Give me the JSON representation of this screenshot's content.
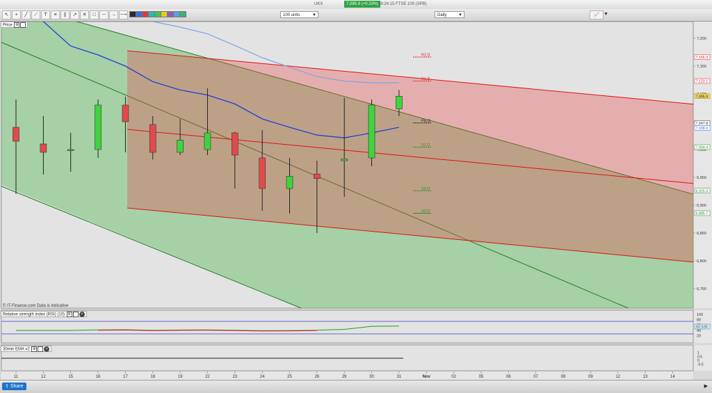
{
  "header": {
    "instrument": "UKX",
    "price_badge": "7,095.9 (+0.23%)",
    "info": "08:24:15 FTSE 100 (SPB)"
  },
  "toolbar": {
    "units_select": "100 units",
    "period_select": "Daily",
    "swatch_colors": [
      "#2b2b2b",
      "#3a6ed8",
      "#d83a3a",
      "#2bb8b8",
      "#4ac24a",
      "#e0d020",
      "#9b59b6",
      "#5aa0e0",
      "#3cb371"
    ]
  },
  "price_panel": {
    "title": "Price",
    "copyright": "© IT-Finance.com  Data is indicative",
    "y_ticks": [
      "7,200",
      "7,150",
      "7,100",
      "7,050",
      "7,000",
      "6,950",
      "6,900",
      "6,850",
      "6,800",
      "6,750"
    ],
    "right_badges": [
      {
        "text": "7,166.3",
        "value": 7166.3,
        "color": "#d22"
      },
      {
        "text": "7,123.1",
        "value": 7123.1,
        "color": "#d22"
      },
      {
        "text": "7,095.9",
        "value": 7095.9,
        "color": "#f3d65a"
      },
      {
        "text": "7,047.8",
        "value": 7047.8,
        "color": "#333"
      },
      {
        "text": "7,038.9",
        "value": 7038.9,
        "color": "#3a6ed8"
      },
      {
        "text": "7,004.4",
        "value": 7004.4,
        "color": "#2a8a2a"
      },
      {
        "text": "6,925.9",
        "value": 6925.9,
        "color": "#2a8a2a"
      },
      {
        "text": "6,885.7",
        "value": 6885.7,
        "color": "#2a8a2a"
      }
    ],
    "pivots": [
      {
        "label": "R2 D",
        "value": 7166.3,
        "color": "#d22"
      },
      {
        "label": "R1 D",
        "value": 7123.1,
        "color": "#d22"
      },
      {
        "label": "Piv D",
        "value": 7047.8,
        "color": "#222"
      },
      {
        "label": "S1 D",
        "value": 7004.4,
        "color": "#2a8a2a"
      },
      {
        "label": "S2 D",
        "value": 6925.9,
        "color": "#2a8a2a"
      },
      {
        "label": "S3 D",
        "value": 6885.7,
        "color": "#2a8a2a"
      }
    ]
  },
  "rsi_panel": {
    "title": "Relative strength index (RSI) (10)",
    "y_ticks": [
      "100",
      "80",
      "60",
      "40",
      "20"
    ],
    "value_badge": "60.536"
  },
  "ema_panel": {
    "title": "30min EMA v2",
    "y_ticks": [
      "1",
      "0.5",
      "0",
      "-0.5"
    ]
  },
  "x_axis": {
    "labels": [
      "11",
      "12",
      "15",
      "16",
      "17",
      "18",
      "19",
      "22",
      "23",
      "24",
      "25",
      "26",
      "29",
      "30",
      "31",
      "Nov",
      "02",
      "05",
      "06",
      "07",
      "08",
      "09",
      "12",
      "13",
      "14"
    ]
  },
  "footer": {
    "share_label": "Share"
  },
  "chart_data": {
    "type": "candlestick",
    "categories": [
      "11",
      "12",
      "15",
      "16",
      "17",
      "18",
      "19",
      "22",
      "23",
      "24",
      "25",
      "26",
      "29",
      "30",
      "31"
    ],
    "candles": [
      {
        "open": 7040,
        "high": 7090,
        "low": 6920,
        "close": 7015
      },
      {
        "open": 7010,
        "high": 7060,
        "low": 6955,
        "close": 6995
      },
      {
        "open": 6998,
        "high": 7030,
        "low": 6960,
        "close": 7000
      },
      {
        "open": 7000,
        "high": 7090,
        "low": 6985,
        "close": 7080
      },
      {
        "open": 7080,
        "high": 7095,
        "low": 6995,
        "close": 7050
      },
      {
        "open": 7045,
        "high": 7060,
        "low": 6982,
        "close": 6995
      },
      {
        "open": 6995,
        "high": 7055,
        "low": 6990,
        "close": 7017
      },
      {
        "open": 7000,
        "high": 7110,
        "low": 6990,
        "close": 7030
      },
      {
        "open": 7030,
        "high": 7032,
        "low": 6930,
        "close": 6990
      },
      {
        "open": 6985,
        "high": 7035,
        "low": 6890,
        "close": 6930
      },
      {
        "open": 6930,
        "high": 6985,
        "low": 6885,
        "close": 6952
      },
      {
        "open": 6956,
        "high": 6980,
        "low": 6850,
        "close": 6948
      },
      {
        "open": 6980,
        "high": 7093,
        "low": 6915,
        "close": 6983
      },
      {
        "open": 6985,
        "high": 7090,
        "low": 6970,
        "close": 7080
      },
      {
        "open": 7073,
        "high": 7107,
        "low": 7060,
        "close": 7095.9
      }
    ],
    "ma_blue": [
      7260,
      7230,
      7186,
      7170,
      7150,
      7122,
      7107,
      7098,
      7082,
      7055,
      7040,
      7026,
      7021,
      7030,
      7040
    ],
    "ma_lightblue": [
      7290,
      7280,
      7270,
      7255,
      7245,
      7230,
      7220,
      7208,
      7187,
      7165,
      7148,
      7131,
      7123,
      7120,
      7120
    ],
    "rsi": [
      39.5,
      39.5,
      39.5,
      41.5,
      42,
      39.8,
      41,
      41.5,
      40,
      38.5,
      39,
      40,
      43.5,
      55,
      56
    ],
    "ylim": [
      6715,
      7230
    ],
    "rsi_lim": [
      0,
      100
    ]
  }
}
